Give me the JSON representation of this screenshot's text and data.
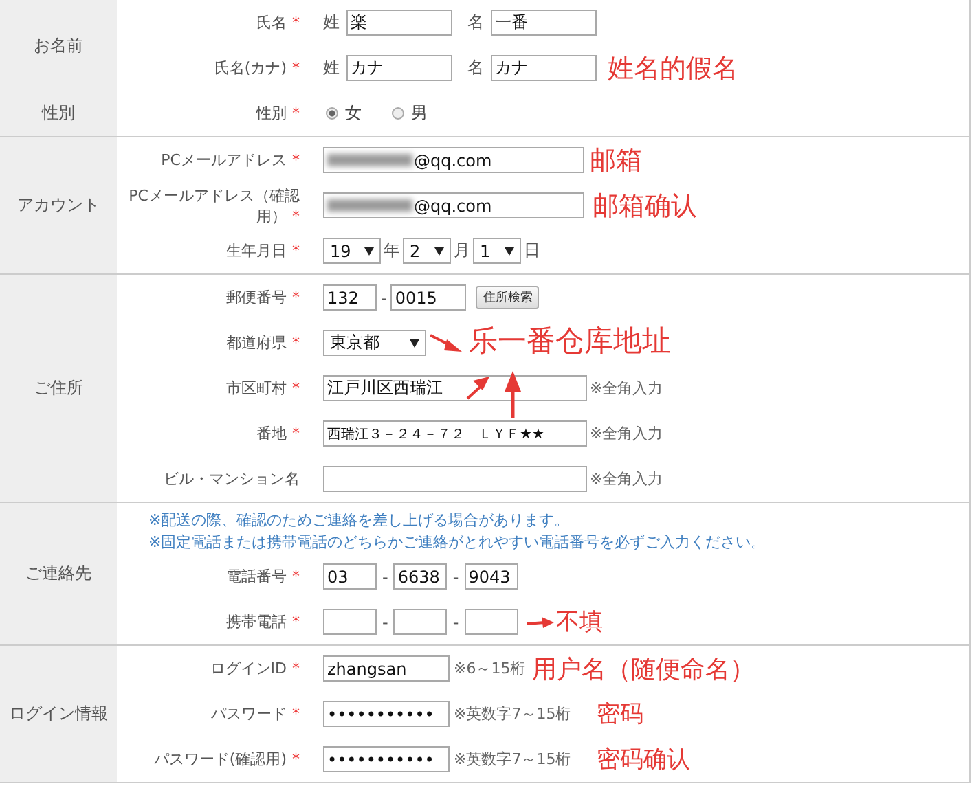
{
  "sections": [
    {
      "groups": [
        {
          "label": "お名前",
          "rows": [
            {
              "kind": "name_pair",
              "label": "氏名",
              "mark": "*",
              "parts": [
                {
                  "prefix": "姓",
                  "value": "楽"
                },
                {
                  "prefix": "名",
                  "value": "一番"
                }
              ]
            },
            {
              "kind": "name_pair",
              "label": "氏名(カナ)",
              "mark": "*",
              "parts": [
                {
                  "prefix": "姓",
                  "value": "カナ"
                },
                {
                  "prefix": "名",
                  "value": "カナ"
                }
              ],
              "annotation": "姓名的假名"
            }
          ]
        },
        {
          "label": "性別",
          "rows": [
            {
              "kind": "radio",
              "label": "性別",
              "mark": "*",
              "options": [
                {
                  "label": "女",
                  "selected": true
                },
                {
                  "label": "男",
                  "selected": false
                }
              ]
            }
          ]
        }
      ]
    },
    {
      "groups": [
        {
          "label": "アカウント",
          "rows": [
            {
              "kind": "email",
              "label": "PCメールアドレス",
              "mark": "*",
              "value": "@qq.com",
              "annotation": "邮箱"
            },
            {
              "kind": "email",
              "label": "PCメールアドレス（確認用）",
              "mark": "*",
              "value": "@qq.com",
              "annotation": "邮箱确认"
            },
            {
              "kind": "date",
              "label": "生年月日",
              "mark": "*",
              "parts": [
                {
                  "value": "19",
                  "unit": "年"
                },
                {
                  "value": "2",
                  "unit": "月"
                },
                {
                  "value": "1",
                  "unit": "日"
                }
              ]
            }
          ]
        }
      ]
    },
    {
      "groups": [
        {
          "label": "ご住所",
          "rows": [
            {
              "kind": "zip",
              "label": "郵便番号",
              "mark": "*",
              "parts": [
                {
                  "value": "132"
                },
                {
                  "value": "0015"
                }
              ],
              "separator": "-",
              "button": "住所検索"
            },
            {
              "kind": "select",
              "label": "都道府県",
              "mark": "*",
              "value": "東京都",
              "annotation": "乐一番仓库地址"
            },
            {
              "kind": "address",
              "label": "市区町村",
              "mark": "*",
              "value": "江戸川区西瑞江",
              "note": "※全角入力"
            },
            {
              "kind": "address",
              "label": "番地",
              "mark": "*",
              "value": "西瑞江３－２４－７２　ＬＹＦ★★",
              "note": "※全角入力"
            },
            {
              "kind": "address",
              "label": "ビル・マンション名",
              "note": "※全角入力"
            }
          ]
        }
      ]
    },
    {
      "groups": [
        {
          "label": "ご連絡先",
          "rows": [
            {
              "kind": "notes",
              "lines": [
                "※配送の際、確認のためご連絡を差し上げる場合があります。",
                "※固定電話または携帯電話のどちらかご連絡がとれやすい電話番号を必ずご入力ください。"
              ]
            },
            {
              "kind": "phone",
              "label": "電話番号",
              "mark": "*",
              "separators": [
                "-",
                "-"
              ],
              "values": [
                "03",
                "6638",
                "9043"
              ]
            },
            {
              "kind": "phone",
              "label": "携帯電話",
              "mark": "*",
              "separators": [
                "-",
                "-"
              ],
              "annotation": "不填"
            }
          ]
        }
      ]
    },
    {
      "groups": [
        {
          "label": "ログイン情報",
          "rows": [
            {
              "kind": "login",
              "label": "ログインID",
              "mark": "*",
              "value": "zhangsan",
              "note": "※6～15桁",
              "annotation": "用户名（随便命名）"
            },
            {
              "kind": "login",
              "label": "パスワード",
              "mark": "*",
              "value": "•••••••••••",
              "note": "※英数字7～15桁",
              "annotation": "密码"
            },
            {
              "kind": "login",
              "label": "パスワード(確認用)",
              "mark": "*",
              "value": "•••••••••••",
              "note": "※英数字7～15桁",
              "annotation": "密码确认"
            }
          ]
        }
      ]
    }
  ]
}
